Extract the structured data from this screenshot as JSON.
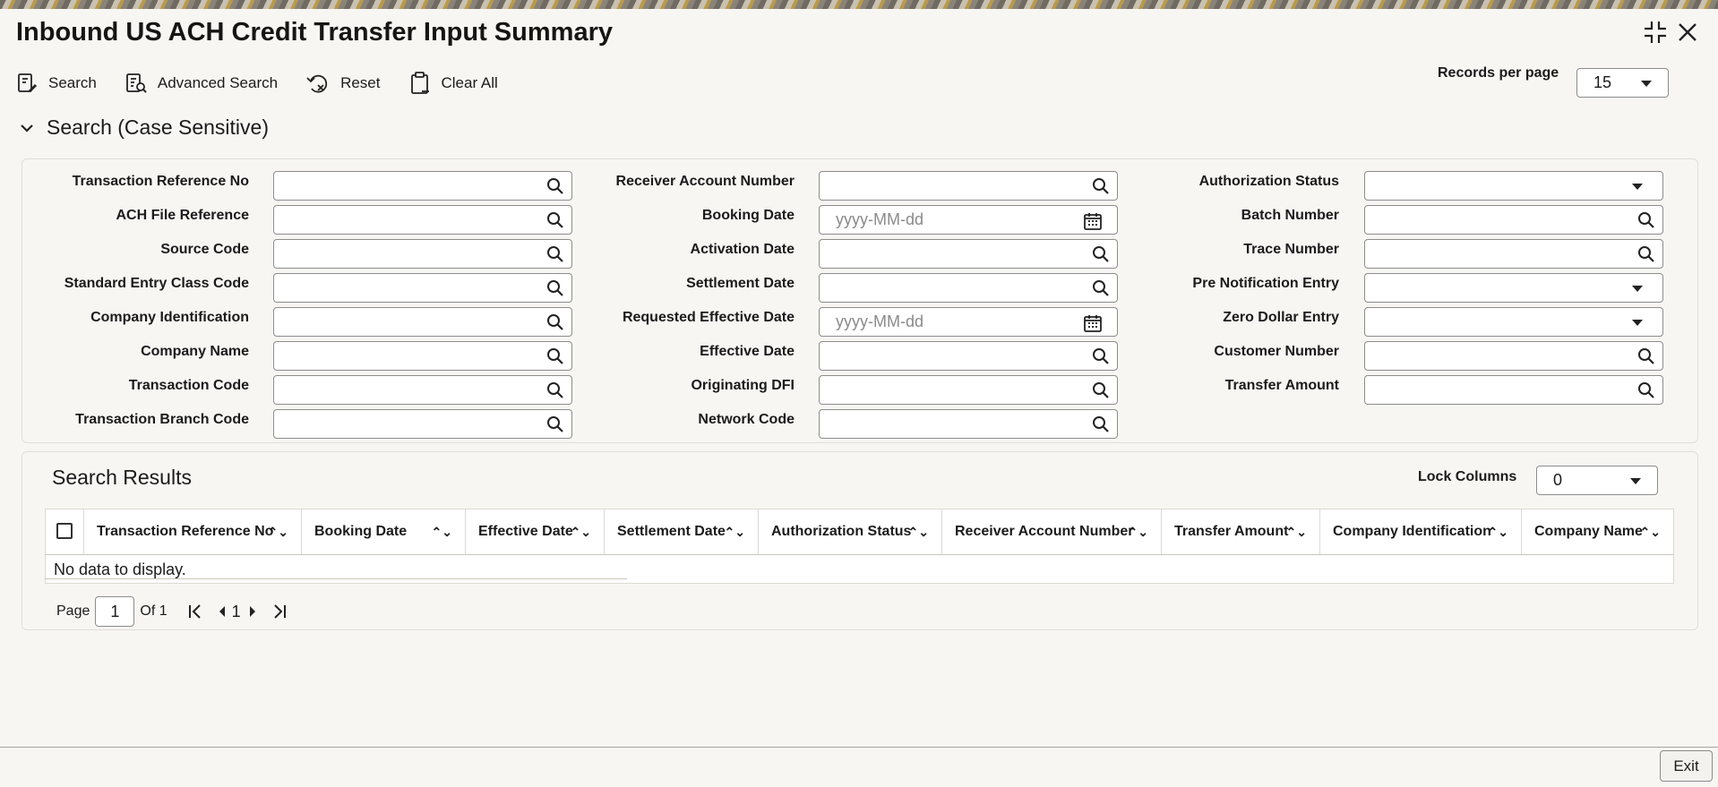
{
  "window": {
    "title": "Inbound US ACH Credit Transfer Input Summary",
    "controls": [
      "minimize-icon",
      "close-icon"
    ]
  },
  "toolbar": {
    "search_label": "Search",
    "advanced_search_label": "Advanced Search",
    "reset_label": "Reset",
    "clear_all_label": "Clear All",
    "records_per_page_label": "Records per page",
    "records_per_page_value": "15"
  },
  "search_section": {
    "title": "Search (Case Sensitive)",
    "fields": {
      "transaction_reference_no": {
        "label": "Transaction Reference No",
        "value": ""
      },
      "ach_file_reference": {
        "label": "ACH File Reference",
        "value": ""
      },
      "source_code": {
        "label": "Source Code",
        "value": ""
      },
      "standard_entry_class_code": {
        "label": "Standard Entry Class Code",
        "value": ""
      },
      "company_identification": {
        "label": "Company Identification",
        "value": ""
      },
      "company_name": {
        "label": "Company Name",
        "value": ""
      },
      "transaction_code": {
        "label": "Transaction Code",
        "value": ""
      },
      "transaction_branch_code": {
        "label": "Transaction Branch Code",
        "value": ""
      },
      "receiver_account_number": {
        "label": "Receiver Account Number",
        "value": ""
      },
      "booking_date": {
        "label": "Booking Date",
        "placeholder": "yyyy-MM-dd"
      },
      "activation_date": {
        "label": "Activation Date",
        "value": ""
      },
      "settlement_date": {
        "label": "Settlement Date",
        "value": ""
      },
      "requested_effective_date": {
        "label": "Requested Effective Date",
        "placeholder": "yyyy-MM-dd"
      },
      "effective_date": {
        "label": "Effective Date",
        "value": ""
      },
      "originating_dfi": {
        "label": "Originating DFI",
        "value": ""
      },
      "network_code": {
        "label": "Network Code",
        "value": ""
      },
      "authorization_status": {
        "label": "Authorization Status",
        "value": ""
      },
      "batch_number": {
        "label": "Batch Number",
        "value": ""
      },
      "trace_number": {
        "label": "Trace Number",
        "value": ""
      },
      "pre_notification_entry": {
        "label": "Pre Notification Entry",
        "value": ""
      },
      "zero_dollar_entry": {
        "label": "Zero Dollar Entry",
        "value": ""
      },
      "customer_number": {
        "label": "Customer Number",
        "value": ""
      },
      "transfer_amount": {
        "label": "Transfer Amount",
        "value": ""
      }
    }
  },
  "results": {
    "title": "Search Results",
    "lock_columns_label": "Lock Columns",
    "lock_columns_value": "0",
    "columns": [
      "Transaction Reference No",
      "Booking Date",
      "Effective Date",
      "Settlement Date",
      "Authorization Status",
      "Receiver Account Number",
      "Transfer Amount",
      "Company Identification",
      "Company Name"
    ],
    "empty_message": "No data to display.",
    "pagination": {
      "page_label": "Page",
      "current_page": "1",
      "of_label": "Of 1",
      "page_number": "1"
    }
  },
  "footer": {
    "exit_label": "Exit"
  }
}
